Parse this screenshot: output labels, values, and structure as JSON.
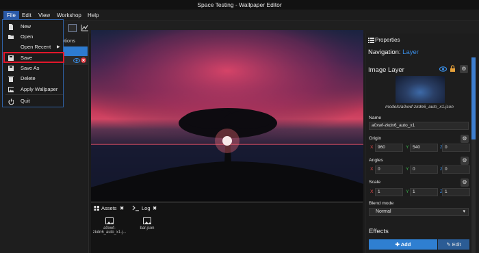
{
  "window": {
    "title": "Space Testing - Wallpaper Editor"
  },
  "menubar": {
    "items": [
      "File",
      "Edit",
      "View",
      "Workshop",
      "Help"
    ]
  },
  "file_menu": {
    "items": [
      {
        "label": "New",
        "icon": "file-icon"
      },
      {
        "label": "Open",
        "icon": "folder-open-icon"
      },
      {
        "label": "Open Recent",
        "icon": "",
        "submenu": true
      },
      {
        "label": "Save",
        "icon": "save-icon",
        "highlighted": true
      },
      {
        "label": "Save As",
        "icon": "save-as-icon"
      },
      {
        "label": "Delete",
        "icon": "trash-icon"
      },
      {
        "label": "Apply Wallpaper",
        "icon": "image-icon"
      },
      {
        "label": "Quit",
        "icon": "power-icon"
      }
    ],
    "submenu_arrow": "▶"
  },
  "left_panel": {
    "tab_partial": "ptions"
  },
  "bottom_panel": {
    "tabs": [
      {
        "label": "Assets",
        "close": "✖"
      },
      {
        "label": "Log",
        "close": "✖"
      }
    ],
    "assets": [
      {
        "name": "a0xwf-zkdn6_auto_x1.j..."
      },
      {
        "name": "bar.json"
      }
    ]
  },
  "properties": {
    "tab_label": "Properties",
    "navigation_label": "Navigation:",
    "navigation_value": "Layer",
    "section_title": "Image Layer",
    "model_caption": "models/a0xwf-zkdn6_auto_x1.json",
    "name": {
      "label": "Name",
      "value": "a0xwf-zkdn6_auto_x1"
    },
    "origin": {
      "label": "Origin",
      "x": "960",
      "y": "540",
      "z": "0"
    },
    "angles": {
      "label": "Angles",
      "x": "0",
      "y": "0",
      "z": "0"
    },
    "scale": {
      "label": "Scale",
      "x": "1",
      "y": "1",
      "z": "1"
    },
    "axis_labels": {
      "x": "X",
      "y": "Y",
      "z": "Z"
    },
    "blend_mode": {
      "label": "Blend mode",
      "value": "Normal"
    },
    "effects_title": "Effects",
    "add_button": "Add",
    "edit_button": "Edit"
  },
  "colors": {
    "accent": "#2f7fd1",
    "highlight_red": "#e3172b",
    "link_blue": "#3a8ee6"
  }
}
